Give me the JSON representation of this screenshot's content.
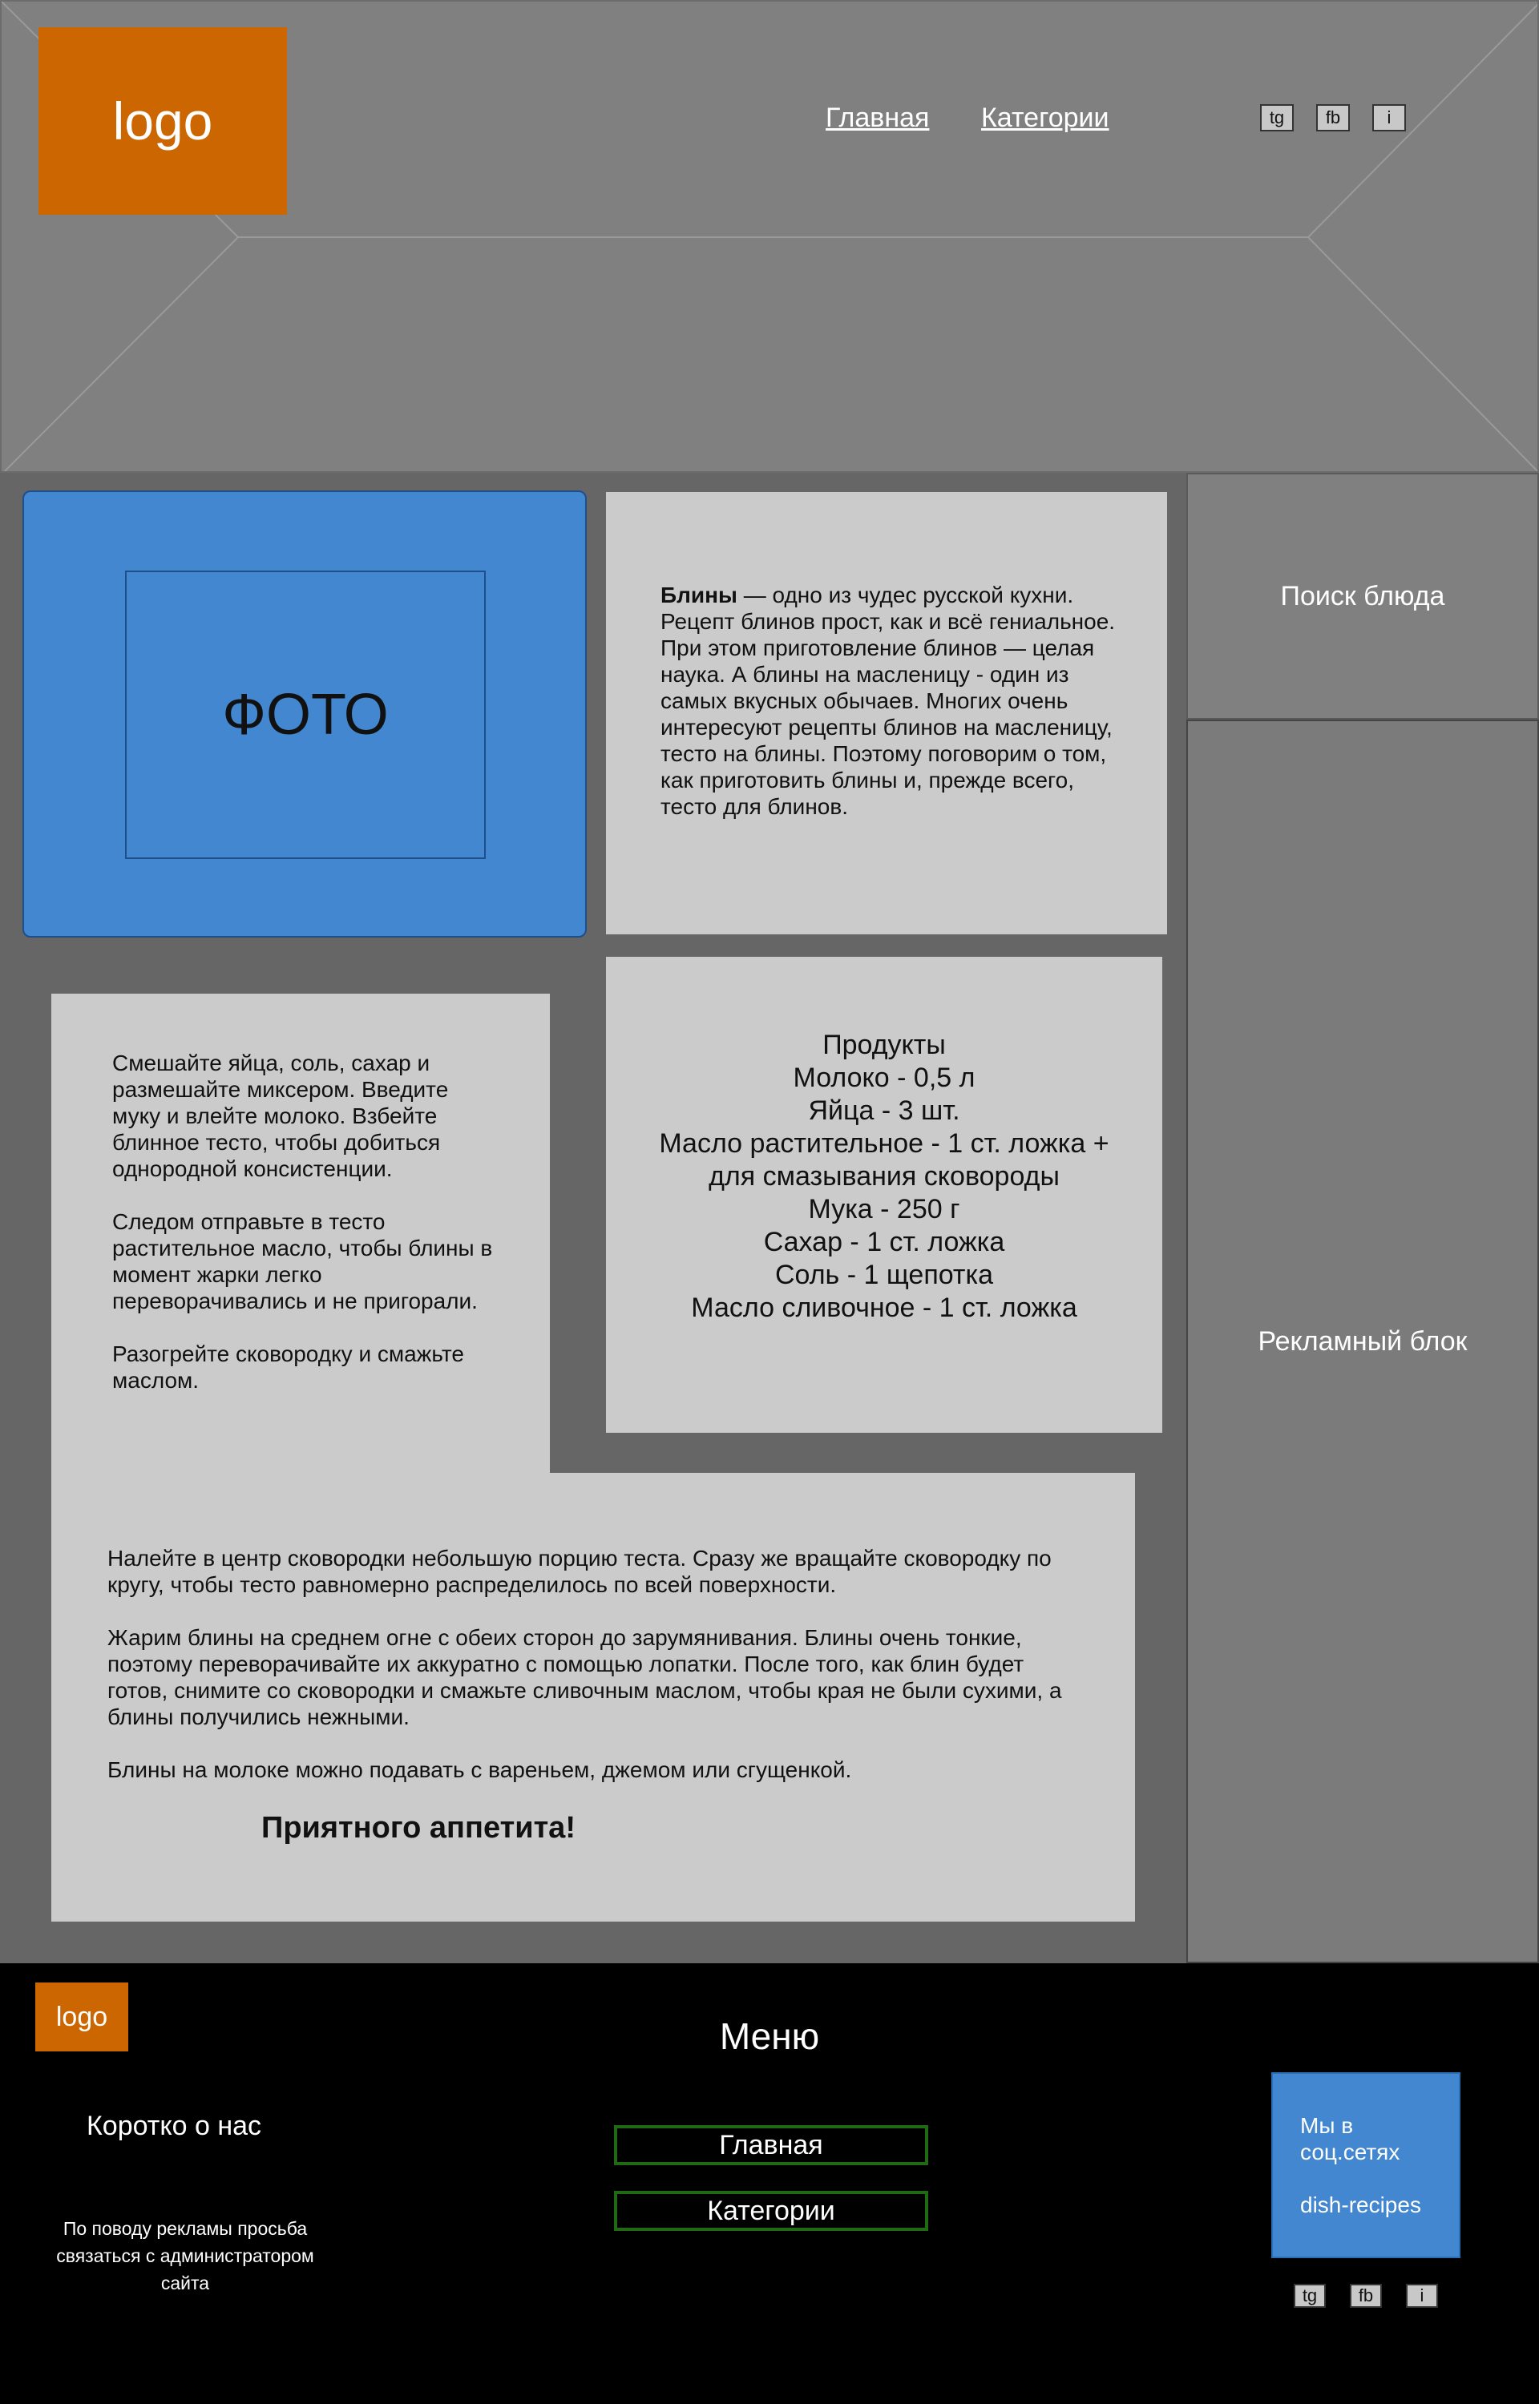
{
  "header": {
    "logo": "logo",
    "nav": [
      {
        "label": "Главная"
      },
      {
        "label": "Категории"
      }
    ],
    "social": [
      {
        "label": "tg"
      },
      {
        "label": "fb"
      },
      {
        "label": "i"
      }
    ]
  },
  "photo": {
    "label": "ФОТО"
  },
  "intro": {
    "title": "Блины",
    "text": " — одно из чудес русской кухни. Рецепт блинов прост, как и всё гениальное. При этом приготовление блинов — целая наука. А блины на масленицу - один из самых вкусных обычаев. Многих очень интересуют рецепты блинов на масленицу, тесто на блины. Поэтому поговорим о том, как приготовить блины и, прежде всего, тесто для блинов."
  },
  "products": {
    "title": "Продукты",
    "items": [
      "Молоко - 0,5 л",
      "Яйца - 3 шт.",
      "Масло растительное - 1 ст. ложка + для смазывания сковороды",
      "Мука - 250 г",
      "Сахар - 1 ст. ложка",
      "Соль - 1 щепотка",
      "Масло сливочное - 1 ст. ложка"
    ]
  },
  "steps_a": [
    "Смешайте яйца, соль, сахар и размешайте миксером. Введите муку и влейте молоко. Взбейте блинное тесто, чтобы добиться однородной консистенции.",
    "Следом отправьте в тесто растительное масло, чтобы блины в момент жарки легко переворачивались и не пригорали.",
    "Разогрейте сковородку и смажьте маслом."
  ],
  "steps_b": [
    "Налейте в центр сковородки небольшую порцию теста. Сразу же вращайте сковородку по кругу, чтобы тесто равномерно распределилось по всей поверхности.",
    "Жарим блины на среднем огне с обеих сторон до зарумянивания. Блины очень тонкие, поэтому переворачивайте их аккуратно с помощью лопатки. После того, как блин будет готов, снимите со сковородки и смажьте сливочным маслом, чтобы края не были сухими, а блины получились нежными.",
    "Блины на молоке можно подавать с вареньем, джемом или сгущенкой."
  ],
  "bon_appetit": "Приятного аппетита!",
  "sidebar": {
    "search": "Поиск блюда",
    "ad": "Рекламный блок"
  },
  "footer": {
    "logo": "logo",
    "menu_title": "Меню",
    "about": "Коротко о нас",
    "ad_note": "По поводу рекламы просьба связаться с администратором сайта",
    "nav": [
      {
        "label": "Главная"
      },
      {
        "label": "Категории"
      }
    ],
    "socials_title": "Мы в соц.сетях",
    "socials_handle": "dish-recipes",
    "social": [
      {
        "label": "tg"
      },
      {
        "label": "fb"
      },
      {
        "label": "i"
      }
    ]
  },
  "colors": {
    "logo_bg": "#cc6600",
    "photo_bg": "#4287cf",
    "card_bg": "#cbcbcb",
    "footer_bg": "#000000",
    "footer_nav_border": "#1f6a13"
  }
}
